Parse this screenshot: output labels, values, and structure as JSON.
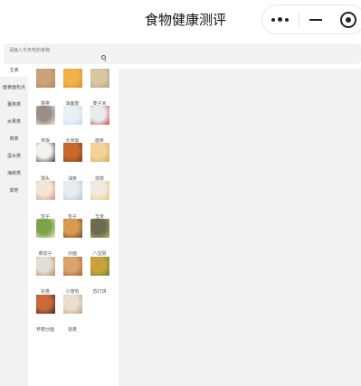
{
  "nav": {
    "title": "食物健康测评"
  },
  "search": {
    "placeholder": "请输入今天吃的食物"
  },
  "sidebar": {
    "items": [
      {
        "label": "主食",
        "active": true
      },
      {
        "label": "面食面包点",
        "active": false
      },
      {
        "label": "薯类类",
        "active": false
      },
      {
        "label": "水果类",
        "active": false
      },
      {
        "label": "肉类",
        "active": false
      },
      {
        "label": "蛋水类",
        "active": false
      },
      {
        "label": "海鲜类",
        "active": false
      },
      {
        "label": "其他",
        "active": false
      }
    ]
  },
  "foods": [
    {
      "name": "",
      "colors": [
        "#c9a37a",
        "#b2865a"
      ]
    },
    {
      "name": "",
      "colors": [
        "#f2b24a",
        "#e08a25"
      ]
    },
    {
      "name": "",
      "colors": [
        "#d9c7a1",
        "#b7a37b"
      ]
    },
    {
      "name": "粥类",
      "colors": [
        "#9a8f87",
        "#f2e6d9"
      ]
    },
    {
      "name": "油面筋",
      "colors": [
        "#eaf1f5",
        "#c8d6e2"
      ]
    },
    {
      "name": "麦子米",
      "colors": [
        "#e7ecef",
        "#c84a3a"
      ]
    },
    {
      "name": "米饭",
      "colors": [
        "#f5f3ef",
        "#3a3a3a"
      ]
    },
    {
      "name": "大米饭",
      "colors": [
        "#c86a2e",
        "#7a3a18"
      ]
    },
    {
      "name": "面条",
      "colors": [
        "#f2d39b",
        "#d9a85a"
      ]
    },
    {
      "name": "馒头",
      "colors": [
        "#f4e5d6",
        "#c9927d"
      ]
    },
    {
      "name": "油条",
      "colors": [
        "#e8ecef",
        "#a7c4d4"
      ]
    },
    {
      "name": "烧饼",
      "colors": [
        "#f0eae1",
        "#e7c46a"
      ]
    },
    {
      "name": "饺子",
      "colors": [
        "#7ba34a",
        "#f2ebd6"
      ]
    },
    {
      "name": "包子",
      "colors": [
        "#d99a4f",
        "#6a4a2a"
      ]
    },
    {
      "name": "玉米",
      "colors": [
        "#6d6a4f",
        "#a9b15e"
      ]
    },
    {
      "name": "菜饺子",
      "colors": [
        "#e3ddd8",
        "#b9895d"
      ]
    },
    {
      "name": "炒面",
      "colors": [
        "#d9a36e",
        "#a85d38"
      ]
    },
    {
      "name": "八宝粥",
      "colors": [
        "#c9a23a",
        "#5a8a3a"
      ]
    },
    {
      "name": "花卷",
      "colors": [
        "#c96a3a",
        "#3a2a22"
      ]
    },
    {
      "name": "小笼包",
      "colors": [
        "#eadfce",
        "#b9a17e"
      ]
    },
    {
      "name": "苏打饼",
      "colors": null
    },
    {
      "name": "荞麦炒面",
      "colors": null
    },
    {
      "name": "烧麦",
      "colors": null
    }
  ]
}
